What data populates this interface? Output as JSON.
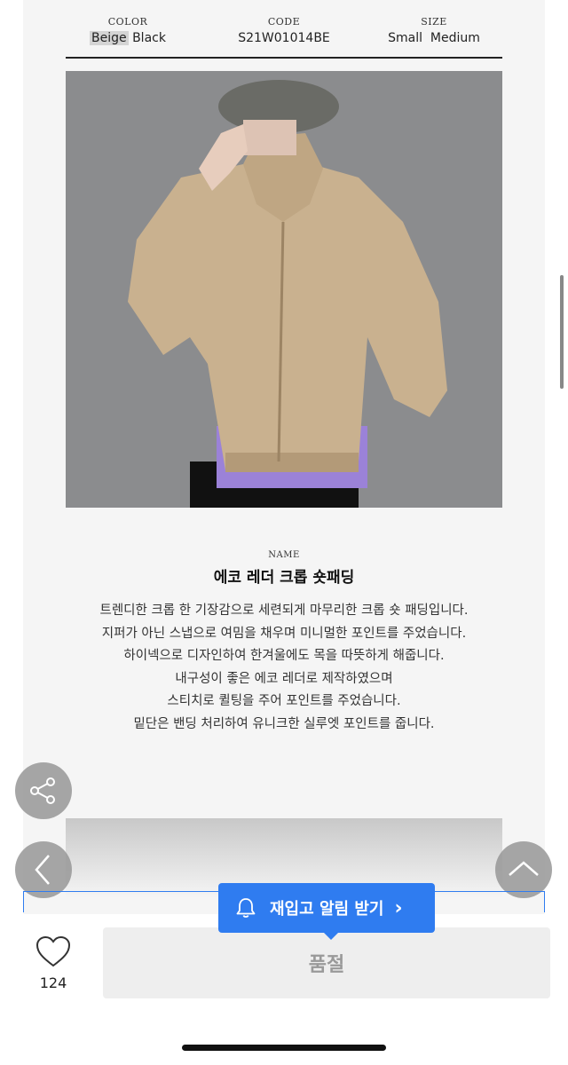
{
  "specs": {
    "color": {
      "title": "COLOR",
      "selected": "Beige",
      "other": "Black"
    },
    "code": {
      "title": "CODE",
      "value": "S21W01014BE"
    },
    "size": {
      "title": "SIZE",
      "value": "Small  Medium"
    }
  },
  "product": {
    "name_title": "NAME",
    "name": "에코 레더 크롭 숏패딩",
    "description": [
      "트렌디한 크롭 한 기장감으로 세련되게 마무리한 크롭 숏 패딩입니다.",
      "지퍼가 아닌 스냅으로 여밈을 채우며 미니멀한 포인트를 주었습니다.",
      "하이넥으로 디자인하여 한겨울에도 목을 따뜻하게 해줍니다.",
      "내구성이 좋은 에코 레더로 제작하였으며",
      "스티치로 퀼팅을 주어 포인트를 주었습니다.",
      "밑단은 밴딩 처리하여 유니크한 실루엣 포인트를 줍니다."
    ]
  },
  "actions": {
    "restock_label": "재입고 알림 받기",
    "restock_chevron": "›",
    "soldout_label": "품절",
    "like_count": "124"
  },
  "colors": {
    "accent": "#2f7cf0",
    "jacket": "#c9b18f",
    "background": "#8b8c8e"
  }
}
